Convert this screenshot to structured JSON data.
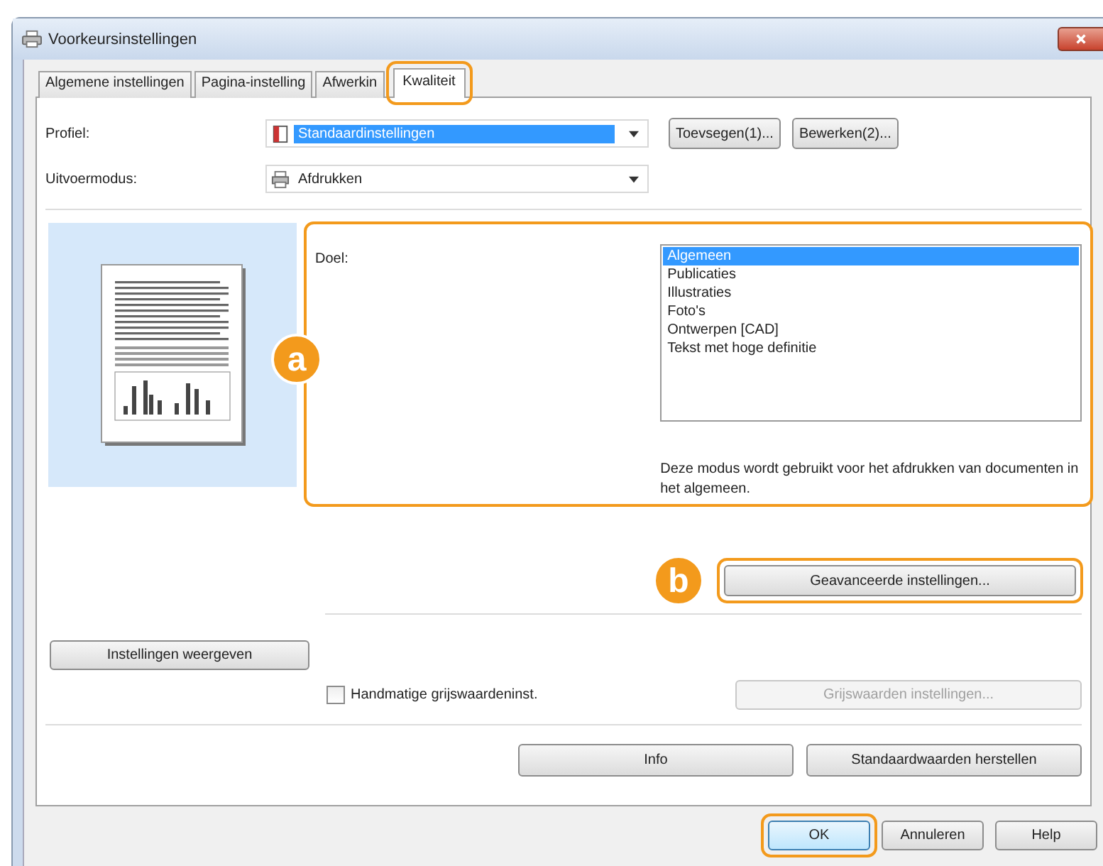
{
  "window": {
    "title": "Voorkeursinstellingen"
  },
  "tabs": [
    {
      "label": "Algemene instellingen",
      "selected": false,
      "highlighted": false
    },
    {
      "label": "Pagina-instelling",
      "selected": false,
      "highlighted": false
    },
    {
      "label": "Afwerkin",
      "selected": false,
      "highlighted": false
    },
    {
      "label": "Kwaliteit",
      "selected": true,
      "highlighted": true
    }
  ],
  "profile": {
    "label": "Profiel:",
    "value": "Standaardinstellingen",
    "buttons": [
      "Toevsegen(1)...",
      "Bewerken(2)..."
    ]
  },
  "output_mode": {
    "label": "Uitvoermodus:",
    "value": "Afdrukken"
  },
  "goal": {
    "label": "Doel:",
    "badge": "a",
    "items": [
      {
        "label": "Algemeen",
        "selected": true
      },
      {
        "label": "Publicaties",
        "selected": false
      },
      {
        "label": "Illustraties",
        "selected": false
      },
      {
        "label": "Foto's",
        "selected": false
      },
      {
        "label": "Ontwerpen [CAD]",
        "selected": false
      },
      {
        "label": "Tekst met hoge definitie",
        "selected": false
      }
    ],
    "description": "Deze modus wordt gebruikt voor het afdrukken van documenten in het algemeen."
  },
  "advanced": {
    "label": "Geavanceerde instellingen...",
    "badge": "b"
  },
  "show_settings_button": "Instellingen weergeven",
  "manual_gray": {
    "label": "Handmatige grijswaardeninst.",
    "checked": false
  },
  "gray_settings_button": {
    "label": "Grijswaarden instellingen...",
    "disabled": true
  },
  "footer_buttons": [
    "Info",
    "Standaardwaarden herstellen"
  ],
  "dialog_buttons": [
    {
      "label": "OK",
      "highlighted": true
    },
    {
      "label": "Annuleren",
      "highlighted": false
    },
    {
      "label": "Help",
      "highlighted": false
    }
  ]
}
